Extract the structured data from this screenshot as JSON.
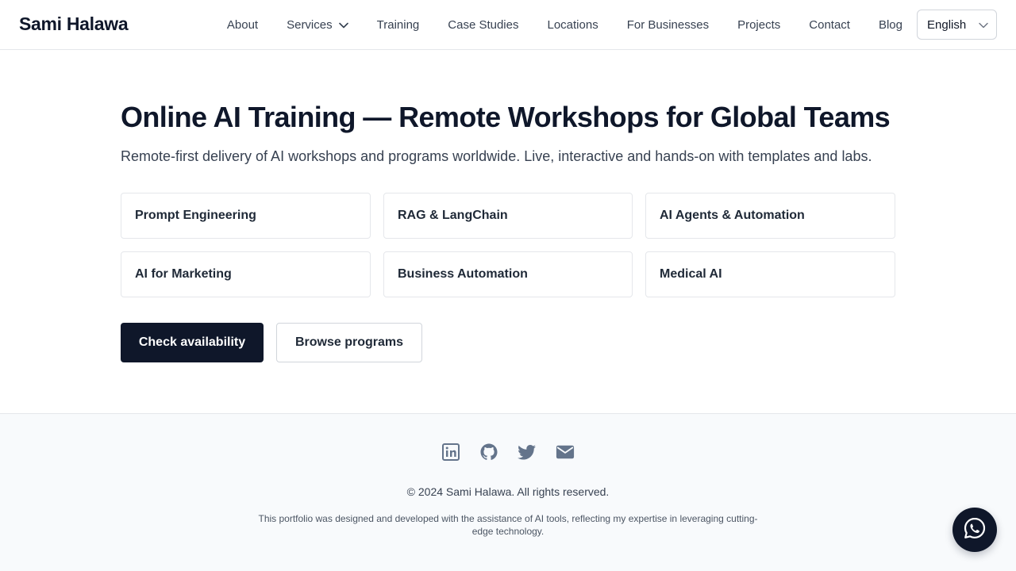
{
  "header": {
    "brand": "Sami Halawa",
    "nav": [
      {
        "label": "About"
      },
      {
        "label": "Services",
        "has_dropdown": true
      },
      {
        "label": "Training"
      },
      {
        "label": "Case Studies"
      },
      {
        "label": "Locations"
      },
      {
        "label": "For Businesses"
      },
      {
        "label": "Projects"
      },
      {
        "label": "Contact"
      },
      {
        "label": "Blog"
      }
    ],
    "language": {
      "selected": "English",
      "icon": "chevron-down-icon"
    }
  },
  "main": {
    "title": "Online AI Training — Remote Workshops for Global Teams",
    "subtitle": "Remote-first delivery of AI workshops and programs worldwide. Live, interactive and hands-on with templates and labs.",
    "topics": [
      "Prompt Engineering",
      "RAG & LangChain",
      "AI Agents & Automation",
      "AI for Marketing",
      "Business Automation",
      "Medical AI"
    ],
    "primary_button": "Check availability",
    "secondary_button": "Browse programs"
  },
  "footer": {
    "social_icons": [
      "linkedin-icon",
      "github-icon",
      "twitter-icon",
      "email-icon"
    ],
    "copyright": "© 2024 Sami Halawa. All rights reserved.",
    "disclaimer": "This portfolio was designed and developed with the assistance of AI tools, reflecting my expertise in leveraging cutting-edge technology."
  },
  "floating": {
    "icon": "whatsapp-icon"
  },
  "colors": {
    "primary": "#0f172a",
    "footer_bg": "#f8fafc",
    "icon_gray": "#64748b",
    "border": "#e5e7eb"
  }
}
